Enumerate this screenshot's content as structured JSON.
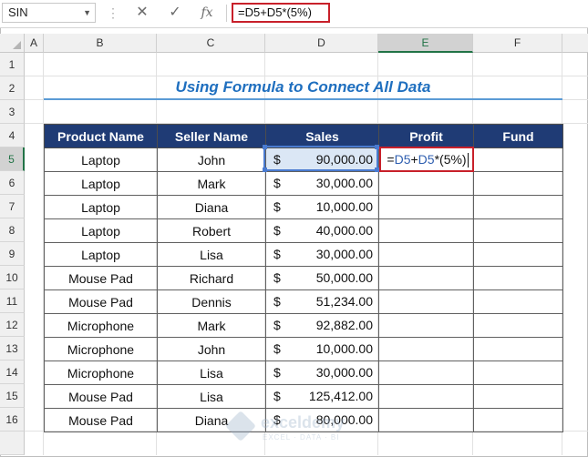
{
  "formula_bar": {
    "name_box": "SIN",
    "cancel_icon": "✕",
    "enter_icon": "✓",
    "fx_label": "fx",
    "formula": "=D5+D5*(5%)"
  },
  "columns": [
    "A",
    "B",
    "C",
    "D",
    "E",
    "F"
  ],
  "selected_column": "E",
  "rows": [
    "1",
    "2",
    "3",
    "4",
    "5",
    "6",
    "7",
    "8",
    "9",
    "10",
    "11",
    "12",
    "13",
    "14",
    "15",
    "16"
  ],
  "selected_row": "5",
  "sheet": {
    "title": "Using Formula to Connect All Data",
    "headers": [
      "Product Name",
      "Seller Name",
      "Sales",
      "Profit",
      "Fund"
    ],
    "currency_symbol": "$",
    "editing_formula": {
      "eq": "=",
      "ref1": "D5",
      "plus": "+",
      "ref2": "D5",
      "rest": "*(5%)"
    },
    "records": [
      {
        "product": "Laptop",
        "seller": "John",
        "sales": "90,000.00"
      },
      {
        "product": "Laptop",
        "seller": "Mark",
        "sales": "30,000.00"
      },
      {
        "product": "Laptop",
        "seller": "Diana",
        "sales": "10,000.00"
      },
      {
        "product": "Laptop",
        "seller": "Robert",
        "sales": "40,000.00"
      },
      {
        "product": "Laptop",
        "seller": "Lisa",
        "sales": "30,000.00"
      },
      {
        "product": "Mouse Pad",
        "seller": "Richard",
        "sales": "50,000.00"
      },
      {
        "product": "Mouse Pad",
        "seller": "Dennis",
        "sales": "51,234.00"
      },
      {
        "product": "Microphone",
        "seller": "Mark",
        "sales": "92,882.00"
      },
      {
        "product": "Microphone",
        "seller": "John",
        "sales": "10,000.00"
      },
      {
        "product": "Microphone",
        "seller": "Lisa",
        "sales": "30,000.00"
      },
      {
        "product": "Mouse Pad",
        "seller": "Lisa",
        "sales": "125,412.00"
      },
      {
        "product": "Mouse Pad",
        "seller": "Diana",
        "sales": "80,000.00"
      }
    ]
  },
  "watermark": {
    "name": "exceldemy",
    "tagline": "EXCEL · DATA · BI"
  },
  "colors": {
    "header_fill": "#1f3b75",
    "title_text": "#1f6fbf",
    "highlight_border": "#c8202a",
    "reference_border": "#4a7bd0"
  }
}
